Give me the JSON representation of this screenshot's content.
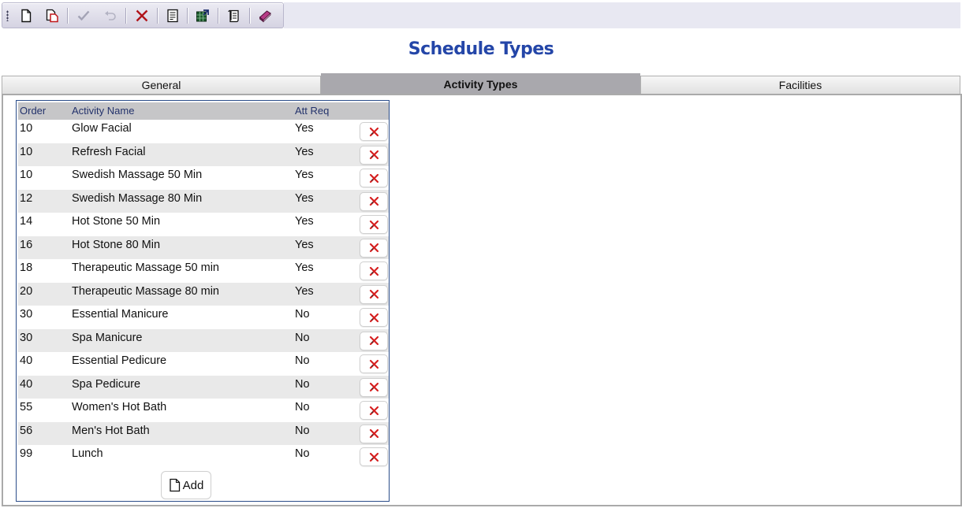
{
  "toolbar": {
    "items": [
      {
        "icon": "new-document-icon",
        "enabled": true
      },
      {
        "icon": "copy-document-icon",
        "enabled": true
      },
      {
        "icon": "checkmark-icon",
        "enabled": false
      },
      {
        "icon": "undo-icon",
        "enabled": false
      },
      {
        "icon": "delete-x-icon",
        "enabled": true
      },
      {
        "icon": "report-icon",
        "enabled": true
      },
      {
        "icon": "export-icon",
        "enabled": true
      },
      {
        "icon": "scroll-icon",
        "enabled": true
      },
      {
        "icon": "help-book-icon",
        "enabled": true
      }
    ]
  },
  "page": {
    "title": "Schedule Types"
  },
  "tabs": [
    {
      "label": "General",
      "active": false
    },
    {
      "label": "Activity Types",
      "active": true
    },
    {
      "label": "Facilities",
      "active": false
    }
  ],
  "grid": {
    "columns": {
      "order": "Order",
      "name": "Activity Name",
      "att_req": "Att Req"
    },
    "rows": [
      {
        "order": "10",
        "name": "Glow Facial",
        "att_req": "Yes"
      },
      {
        "order": "10",
        "name": "Refresh Facial",
        "att_req": "Yes"
      },
      {
        "order": "10",
        "name": "Swedish Massage 50 Min",
        "att_req": "Yes"
      },
      {
        "order": "12",
        "name": "Swedish Massage 80 Min",
        "att_req": "Yes"
      },
      {
        "order": "14",
        "name": "Hot Stone 50 Min",
        "att_req": "Yes"
      },
      {
        "order": "16",
        "name": "Hot Stone 80 Min",
        "att_req": "Yes"
      },
      {
        "order": "18",
        "name": "Therapeutic Massage 50 min",
        "att_req": "Yes"
      },
      {
        "order": "20",
        "name": "Therapeutic Massage 80 min",
        "att_req": "Yes"
      },
      {
        "order": "30",
        "name": "Essential Manicure",
        "att_req": "No"
      },
      {
        "order": "30",
        "name": "Spa Manicure",
        "att_req": "No"
      },
      {
        "order": "40",
        "name": "Essential Pedicure",
        "att_req": "No"
      },
      {
        "order": "40",
        "name": "Spa Pedicure",
        "att_req": "No"
      },
      {
        "order": "55",
        "name": "Women's Hot Bath",
        "att_req": "No"
      },
      {
        "order": "56",
        "name": "Men's Hot Bath",
        "att_req": "No"
      },
      {
        "order": "99",
        "name": "Lunch",
        "att_req": "No"
      }
    ],
    "add_label": "Add"
  },
  "colors": {
    "title": "#2446a8",
    "active_tab": "#a9a8ad",
    "delete_x": "#d61f1f",
    "grid_border": "#2b4d8a"
  }
}
